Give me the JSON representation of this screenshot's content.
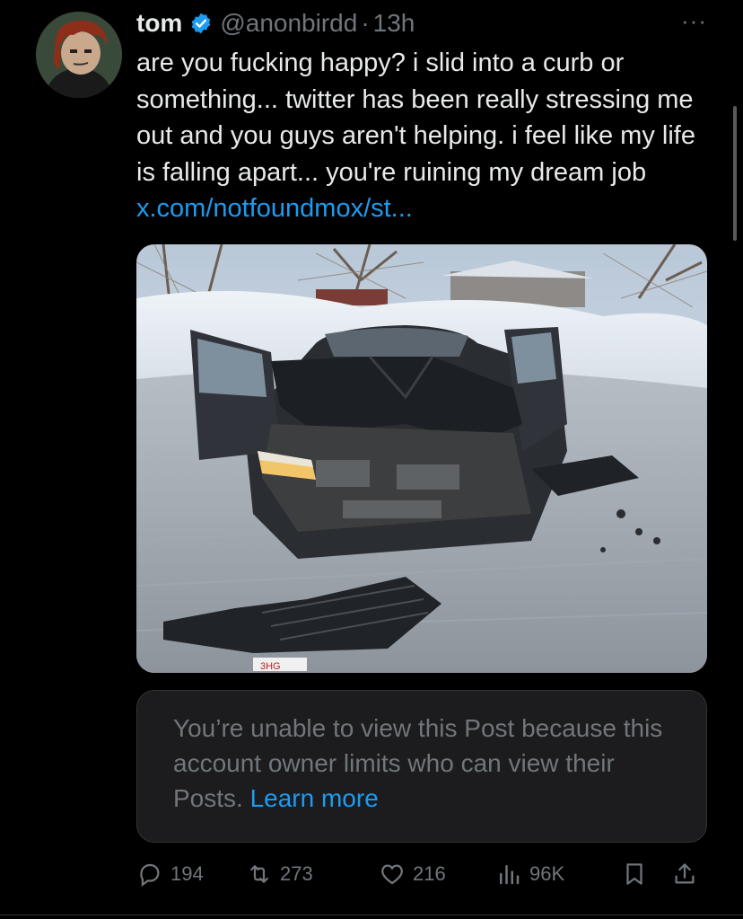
{
  "tweet": {
    "display_name": "tom",
    "handle": "@anonbirdd",
    "separator": "·",
    "time": "13h",
    "more_label": "···",
    "text": "are you fucking happy? i slid into a curb or something... twitter has been really stressing me out and you guys aren't helping. i feel like my life is falling apart... you're ruining my dream job ",
    "link": "x.com/notfoundmox/st..."
  },
  "quote_notice": {
    "text": "You’re unable to view this Post because this account owner limits who can view their Posts. ",
    "learn_more": "Learn more"
  },
  "actions": {
    "replies": "194",
    "reposts": "273",
    "likes": "216",
    "views": "96K"
  },
  "colors": {
    "background": "#000000",
    "text": "#e7e9ea",
    "muted": "#71767b",
    "link": "#1d9bf0",
    "verified": "#1d9bf0"
  },
  "icons": {
    "verified": "verified-badge-icon",
    "more": "more-icon",
    "reply": "reply-icon",
    "repost": "repost-icon",
    "like": "heart-icon",
    "views": "views-icon",
    "bookmark": "bookmark-icon",
    "share": "share-icon"
  }
}
